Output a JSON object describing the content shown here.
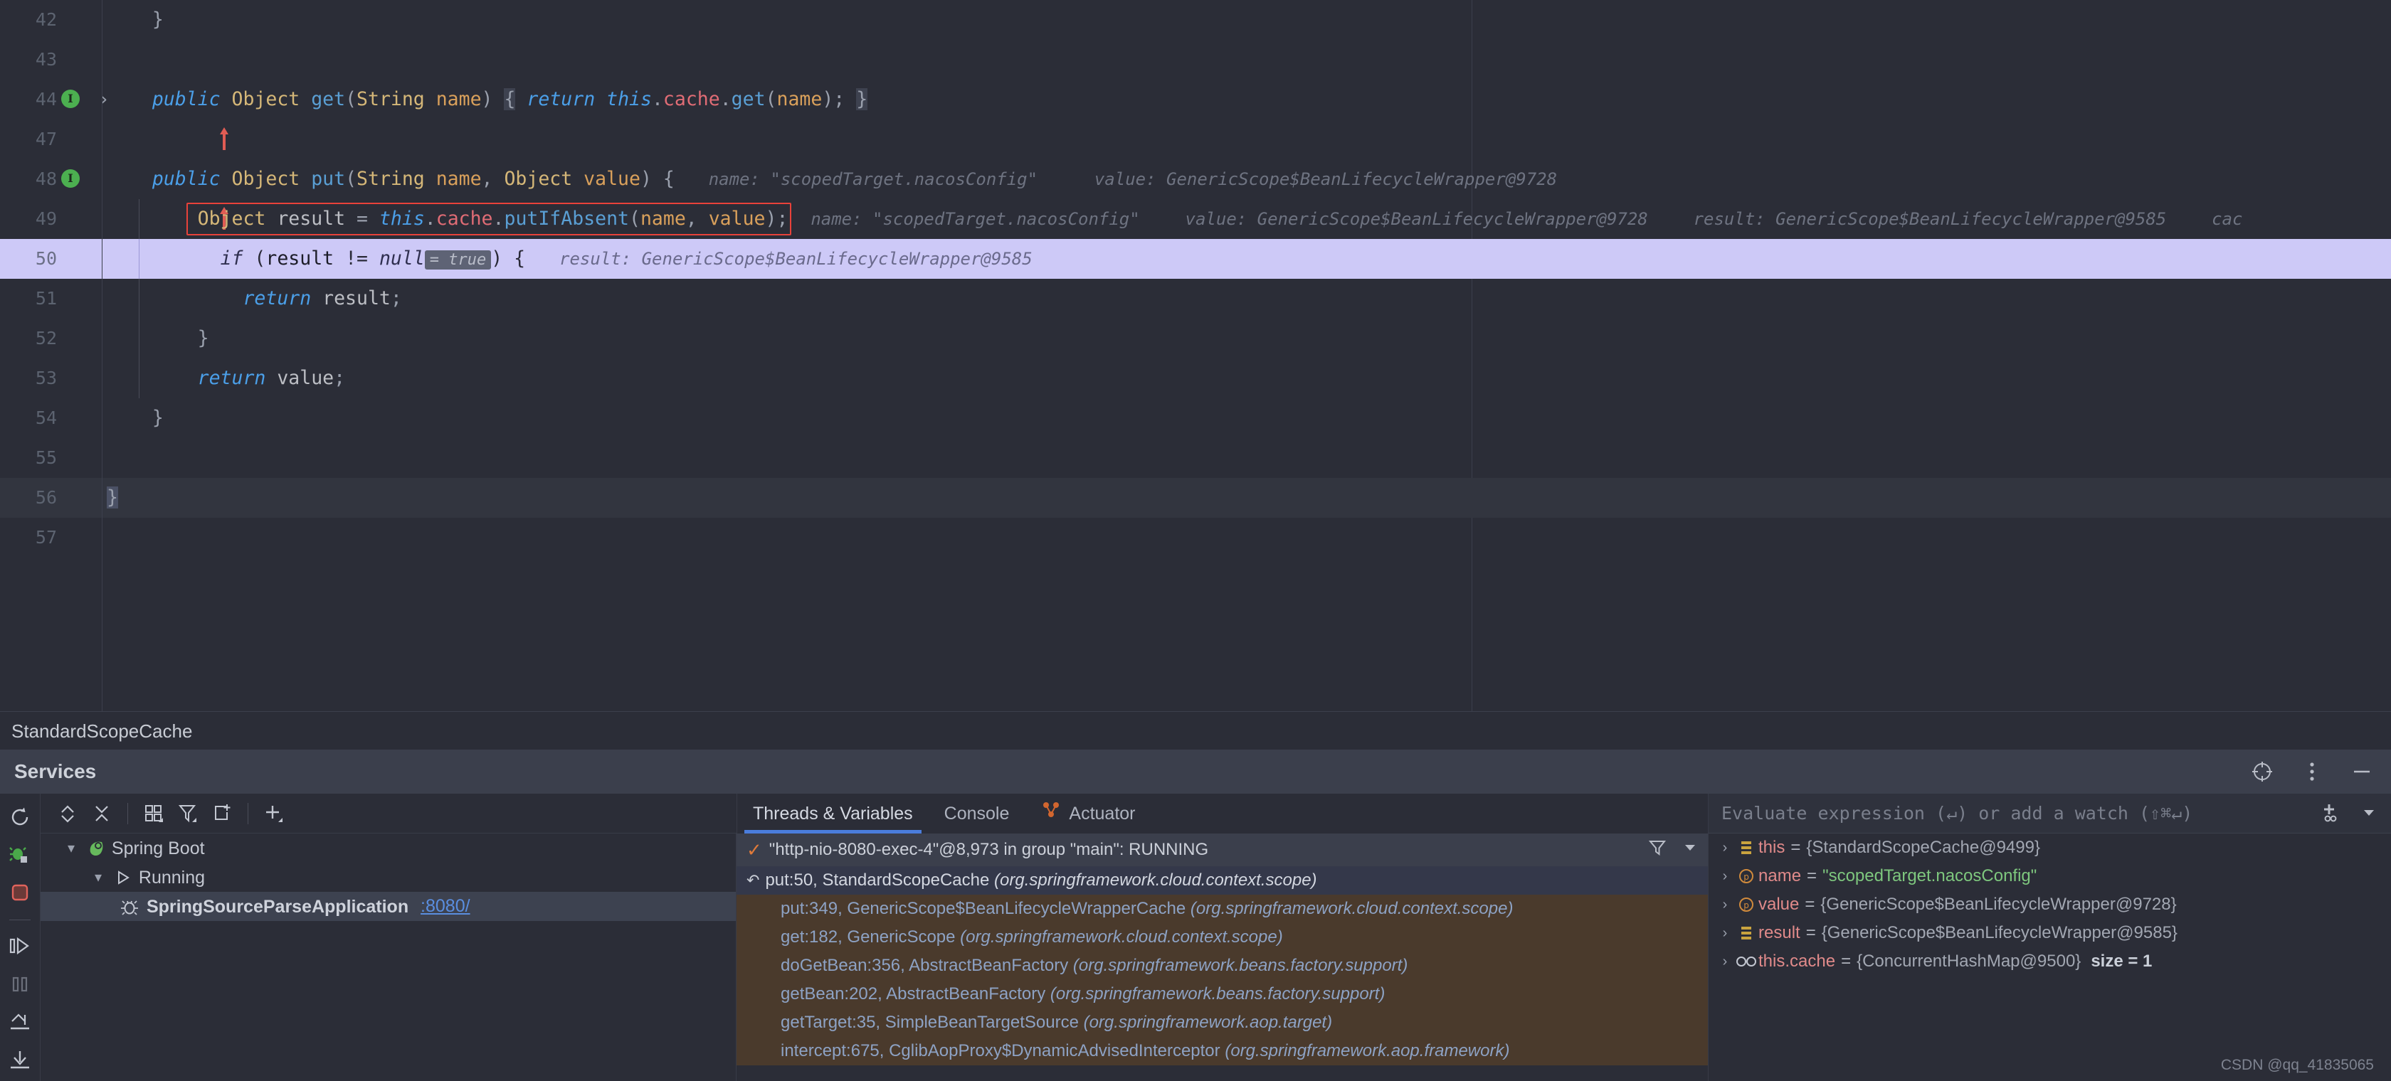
{
  "editor": {
    "breadcrumb": "StandardScopeCache",
    "lines": [
      {
        "num": "42",
        "text": "}"
      },
      {
        "num": "43",
        "text": ""
      },
      {
        "num": "44",
        "text": "public Object get(String name) { return this.cache.get(name); }"
      },
      {
        "num": "47",
        "text": ""
      },
      {
        "num": "48",
        "text": "public Object put(String name, Object value) {",
        "hints": [
          "name: \"scopedTarget.nacosConfig\"",
          "value: GenericScope$BeanLifecycleWrapper@9728"
        ]
      },
      {
        "num": "49",
        "text": "Object result = this.cache.putIfAbsent(name, value);",
        "hints": [
          "name: \"scopedTarget.nacosConfig\"",
          "value: GenericScope$BeanLifecycleWrapper@9728",
          "result: GenericScope$BeanLifecycleWrapper@9585",
          "cac"
        ]
      },
      {
        "num": "50",
        "text": "if (result != null) {",
        "inline_value": "= true",
        "hints": [
          "result: GenericScope$BeanLifecycleWrapper@9585"
        ]
      },
      {
        "num": "51",
        "text": "return result;"
      },
      {
        "num": "52",
        "text": "}"
      },
      {
        "num": "53",
        "text": "return value;"
      },
      {
        "num": "54",
        "text": "}"
      },
      {
        "num": "55",
        "text": ""
      },
      {
        "num": "56",
        "text": "}"
      },
      {
        "num": "57",
        "text": ""
      }
    ],
    "highlight_box_line": "49",
    "highlight_box_color": "#e8423a",
    "current_line": "50",
    "gutter_impl_label": "I"
  },
  "services": {
    "title": "Services",
    "header_icons": [
      "crosshair-icon",
      "more-vertical-icon",
      "minimize-icon"
    ],
    "debug_toolbar": [
      "rerun-icon",
      "debug-icon",
      "stop-icon",
      "resume-icon",
      "pause-icon",
      "step-out-icon",
      "step-into-icon"
    ],
    "tree_toolbar": [
      "expand-collapse-icon",
      "collapse-all-icon",
      "group-by-icon",
      "filter-icon",
      "add-tab-icon",
      "add-service-icon"
    ],
    "tree": [
      {
        "label": "Spring Boot",
        "indent": 0,
        "expanded": true,
        "icon": "spring-leaf-icon"
      },
      {
        "label": "Running",
        "indent": 1,
        "expanded": true,
        "icon": "run-triangle-icon"
      },
      {
        "label": "SpringSourceParseApplication",
        "indent": 2,
        "icon": "bug-icon",
        "link": ":8080/",
        "selected": true,
        "bold": true
      }
    ]
  },
  "debug": {
    "tabs": [
      {
        "label": "Threads & Variables",
        "active": true
      },
      {
        "label": "Console",
        "active": false
      },
      {
        "label": "Actuator",
        "active": false,
        "icon": "actuator-icon"
      }
    ],
    "thread_status": "\"http-nio-8080-exec-4\"@8,973 in group \"main\": RUNNING",
    "thread_bar_icons": [
      "filter-icon",
      "chevron-down-icon"
    ],
    "frames": [
      {
        "method": "put:50, StandardScopeCache",
        "pkg": "(org.springframework.cloud.context.scope)",
        "current": true
      },
      {
        "method": "put:349, GenericScope$BeanLifecycleWrapperCache",
        "pkg": "(org.springframework.cloud.context.scope)",
        "lib": true
      },
      {
        "method": "get:182, GenericScope",
        "pkg": "(org.springframework.cloud.context.scope)",
        "lib": true
      },
      {
        "method": "doGetBean:356, AbstractBeanFactory",
        "pkg": "(org.springframework.beans.factory.support)",
        "lib": true
      },
      {
        "method": "getBean:202, AbstractBeanFactory",
        "pkg": "(org.springframework.beans.factory.support)",
        "lib": true
      },
      {
        "method": "getTarget:35, SimpleBeanTargetSource",
        "pkg": "(org.springframework.aop.target)",
        "lib": true
      },
      {
        "method": "intercept:675, CglibAopProxy$DynamicAdvisedInterceptor",
        "pkg": "(org.springframework.aop.framework)",
        "lib": true
      }
    ],
    "watch_placeholder": "Evaluate expression (↵) or add a watch (⇧⌘↵)",
    "watch_icons": [
      "add-watch-icon",
      "chevron-down-icon"
    ],
    "variables": [
      {
        "name": "this",
        "value": "{StandardScopeCache@9499}",
        "icon": "field-icon",
        "type": "obj"
      },
      {
        "name": "name",
        "value": "\"scopedTarget.nacosConfig\"",
        "icon": "param-icon",
        "type": "str"
      },
      {
        "name": "value",
        "value": "{GenericScope$BeanLifecycleWrapper@9728}",
        "icon": "param-icon",
        "type": "obj"
      },
      {
        "name": "result",
        "value": "{GenericScope$BeanLifecycleWrapper@9585}",
        "icon": "field-icon",
        "type": "obj"
      },
      {
        "name": "this.cache",
        "value": "{ConcurrentHashMap@9500}",
        "icon": "watch-icon",
        "type": "obj",
        "extra": "size = 1"
      }
    ]
  },
  "watermark": "CSDN @qq_41835065"
}
